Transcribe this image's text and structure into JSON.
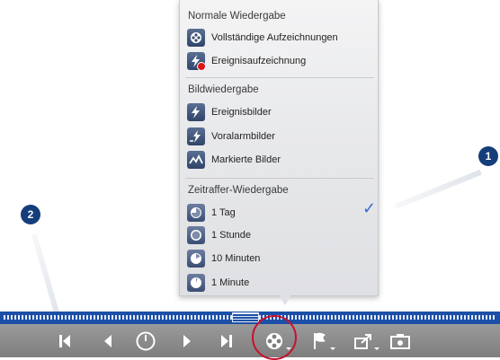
{
  "menu": {
    "sections": [
      {
        "title": "Normale Wiedergabe",
        "items": [
          {
            "label": "Vollständige Aufzeichnungen",
            "icon": "film-reel-icon"
          },
          {
            "label": "Ereignisaufzeichnung",
            "icon": "event-recording-icon"
          }
        ]
      },
      {
        "title": "Bildwiedergabe",
        "items": [
          {
            "label": "Ereignisbilder",
            "icon": "lightning-icon"
          },
          {
            "label": "Voralarmbilder",
            "icon": "pre-alarm-icon"
          },
          {
            "label": "Markierte Bilder",
            "icon": "marked-images-icon"
          }
        ]
      },
      {
        "title": "Zeitraffer-Wiedergabe",
        "items": [
          {
            "label": "1 Tag",
            "icon": "clock-day-icon",
            "selected": true
          },
          {
            "label": "1 Stunde",
            "icon": "clock-hour-icon"
          },
          {
            "label": "10 Minuten",
            "icon": "clock-10min-icon"
          },
          {
            "label": "1 Minute",
            "icon": "clock-minute-icon"
          }
        ]
      }
    ],
    "checkmark": "✓"
  },
  "callouts": {
    "one": "1",
    "two": "2"
  },
  "colors": {
    "callout_bg": "#143d7a",
    "timeline": "#1c50a8",
    "controlbar": "#8a8a8a",
    "check": "#2f6fd6",
    "highlight": "#c8102e",
    "event_dot": "#e01414"
  },
  "controls": [
    {
      "name": "skip-to-start-icon"
    },
    {
      "name": "step-back-icon"
    },
    {
      "name": "live-icon"
    },
    {
      "name": "step-forward-icon"
    },
    {
      "name": "skip-to-end-icon"
    },
    {
      "name": "film-reel-icon",
      "active": true
    },
    {
      "name": "flag-icon"
    },
    {
      "name": "export-icon"
    },
    {
      "name": "snapshot-icon"
    }
  ]
}
